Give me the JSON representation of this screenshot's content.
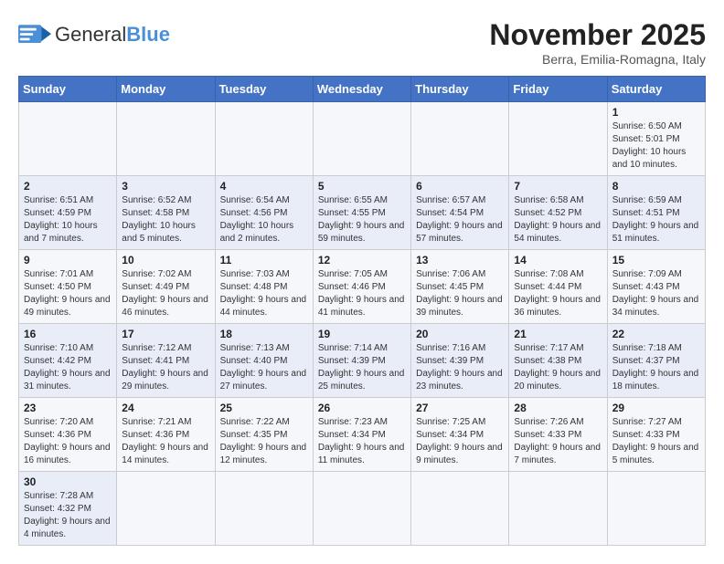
{
  "logo": {
    "text_general": "General",
    "text_blue": "Blue"
  },
  "header": {
    "month_year": "November 2025",
    "location": "Berra, Emilia-Romagna, Italy"
  },
  "weekdays": [
    "Sunday",
    "Monday",
    "Tuesday",
    "Wednesday",
    "Thursday",
    "Friday",
    "Saturday"
  ],
  "weeks": [
    [
      {
        "day": "",
        "info": ""
      },
      {
        "day": "",
        "info": ""
      },
      {
        "day": "",
        "info": ""
      },
      {
        "day": "",
        "info": ""
      },
      {
        "day": "",
        "info": ""
      },
      {
        "day": "",
        "info": ""
      },
      {
        "day": "1",
        "info": "Sunrise: 6:50 AM\nSunset: 5:01 PM\nDaylight: 10 hours and 10 minutes."
      }
    ],
    [
      {
        "day": "2",
        "info": "Sunrise: 6:51 AM\nSunset: 4:59 PM\nDaylight: 10 hours and 7 minutes."
      },
      {
        "day": "3",
        "info": "Sunrise: 6:52 AM\nSunset: 4:58 PM\nDaylight: 10 hours and 5 minutes."
      },
      {
        "day": "4",
        "info": "Sunrise: 6:54 AM\nSunset: 4:56 PM\nDaylight: 10 hours and 2 minutes."
      },
      {
        "day": "5",
        "info": "Sunrise: 6:55 AM\nSunset: 4:55 PM\nDaylight: 9 hours and 59 minutes."
      },
      {
        "day": "6",
        "info": "Sunrise: 6:57 AM\nSunset: 4:54 PM\nDaylight: 9 hours and 57 minutes."
      },
      {
        "day": "7",
        "info": "Sunrise: 6:58 AM\nSunset: 4:52 PM\nDaylight: 9 hours and 54 minutes."
      },
      {
        "day": "8",
        "info": "Sunrise: 6:59 AM\nSunset: 4:51 PM\nDaylight: 9 hours and 51 minutes."
      }
    ],
    [
      {
        "day": "9",
        "info": "Sunrise: 7:01 AM\nSunset: 4:50 PM\nDaylight: 9 hours and 49 minutes."
      },
      {
        "day": "10",
        "info": "Sunrise: 7:02 AM\nSunset: 4:49 PM\nDaylight: 9 hours and 46 minutes."
      },
      {
        "day": "11",
        "info": "Sunrise: 7:03 AM\nSunset: 4:48 PM\nDaylight: 9 hours and 44 minutes."
      },
      {
        "day": "12",
        "info": "Sunrise: 7:05 AM\nSunset: 4:46 PM\nDaylight: 9 hours and 41 minutes."
      },
      {
        "day": "13",
        "info": "Sunrise: 7:06 AM\nSunset: 4:45 PM\nDaylight: 9 hours and 39 minutes."
      },
      {
        "day": "14",
        "info": "Sunrise: 7:08 AM\nSunset: 4:44 PM\nDaylight: 9 hours and 36 minutes."
      },
      {
        "day": "15",
        "info": "Sunrise: 7:09 AM\nSunset: 4:43 PM\nDaylight: 9 hours and 34 minutes."
      }
    ],
    [
      {
        "day": "16",
        "info": "Sunrise: 7:10 AM\nSunset: 4:42 PM\nDaylight: 9 hours and 31 minutes."
      },
      {
        "day": "17",
        "info": "Sunrise: 7:12 AM\nSunset: 4:41 PM\nDaylight: 9 hours and 29 minutes."
      },
      {
        "day": "18",
        "info": "Sunrise: 7:13 AM\nSunset: 4:40 PM\nDaylight: 9 hours and 27 minutes."
      },
      {
        "day": "19",
        "info": "Sunrise: 7:14 AM\nSunset: 4:39 PM\nDaylight: 9 hours and 25 minutes."
      },
      {
        "day": "20",
        "info": "Sunrise: 7:16 AM\nSunset: 4:39 PM\nDaylight: 9 hours and 23 minutes."
      },
      {
        "day": "21",
        "info": "Sunrise: 7:17 AM\nSunset: 4:38 PM\nDaylight: 9 hours and 20 minutes."
      },
      {
        "day": "22",
        "info": "Sunrise: 7:18 AM\nSunset: 4:37 PM\nDaylight: 9 hours and 18 minutes."
      }
    ],
    [
      {
        "day": "23",
        "info": "Sunrise: 7:20 AM\nSunset: 4:36 PM\nDaylight: 9 hours and 16 minutes."
      },
      {
        "day": "24",
        "info": "Sunrise: 7:21 AM\nSunset: 4:36 PM\nDaylight: 9 hours and 14 minutes."
      },
      {
        "day": "25",
        "info": "Sunrise: 7:22 AM\nSunset: 4:35 PM\nDaylight: 9 hours and 12 minutes."
      },
      {
        "day": "26",
        "info": "Sunrise: 7:23 AM\nSunset: 4:34 PM\nDaylight: 9 hours and 11 minutes."
      },
      {
        "day": "27",
        "info": "Sunrise: 7:25 AM\nSunset: 4:34 PM\nDaylight: 9 hours and 9 minutes."
      },
      {
        "day": "28",
        "info": "Sunrise: 7:26 AM\nSunset: 4:33 PM\nDaylight: 9 hours and 7 minutes."
      },
      {
        "day": "29",
        "info": "Sunrise: 7:27 AM\nSunset: 4:33 PM\nDaylight: 9 hours and 5 minutes."
      }
    ],
    [
      {
        "day": "30",
        "info": "Sunrise: 7:28 AM\nSunset: 4:32 PM\nDaylight: 9 hours and 4 minutes."
      },
      {
        "day": "",
        "info": ""
      },
      {
        "day": "",
        "info": ""
      },
      {
        "day": "",
        "info": ""
      },
      {
        "day": "",
        "info": ""
      },
      {
        "day": "",
        "info": ""
      },
      {
        "day": "",
        "info": ""
      }
    ]
  ]
}
